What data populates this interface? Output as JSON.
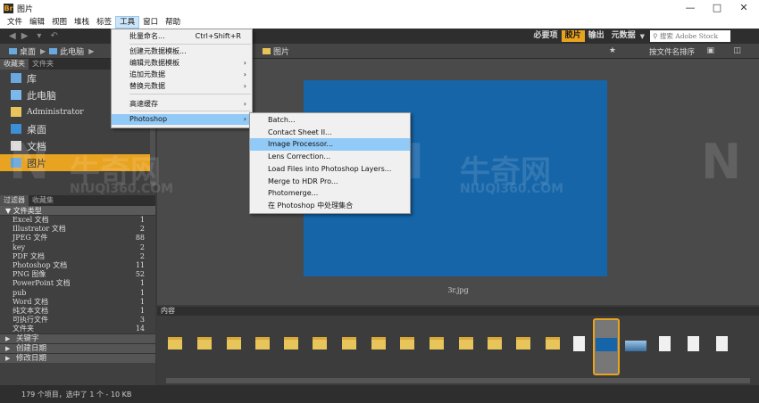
{
  "window": {
    "title": "图片"
  },
  "menubar": {
    "items": [
      "文件",
      "编辑",
      "视图",
      "堆栈",
      "标签",
      "工具",
      "窗口",
      "帮助"
    ],
    "active_index": 5
  },
  "toolbar": {
    "workspaces": [
      "必要项",
      "胶片",
      "输出",
      "元数据"
    ],
    "active_workspace": "胶片",
    "search_placeholder": "搜索 Adobe Stock"
  },
  "pathbar": {
    "crumbs": [
      "桌面",
      "此电脑",
      "图片"
    ],
    "sort_label": "按文件名排序"
  },
  "left_panel": {
    "tabs": [
      "收藏夹",
      "文件夹"
    ],
    "favorites": [
      {
        "label": "库",
        "icon": "library-icon"
      },
      {
        "label": "此电脑",
        "icon": "computer-icon"
      },
      {
        "label": "Administrator",
        "icon": "user-folder-icon"
      },
      {
        "label": "桌面",
        "icon": "desktop-icon"
      },
      {
        "label": "文档",
        "icon": "documents-icon"
      },
      {
        "label": "图片",
        "icon": "pictures-icon",
        "selected": true
      }
    ],
    "filter_tabs": [
      "过滤器",
      "收藏集"
    ],
    "filter_heading": "文件类型",
    "filter_rows": [
      {
        "label": "Excel 文档",
        "count": "1"
      },
      {
        "label": "Illustrator 文档",
        "count": "2"
      },
      {
        "label": "JPEG 文件",
        "count": "88"
      },
      {
        "label": "key",
        "count": "2"
      },
      {
        "label": "PDF 文档",
        "count": "2"
      },
      {
        "label": "Photoshop 文档",
        "count": "11"
      },
      {
        "label": "PNG 图像",
        "count": "52"
      },
      {
        "label": "PowerPoint 文档",
        "count": "1"
      },
      {
        "label": "pub",
        "count": "1"
      },
      {
        "label": "Word 文档",
        "count": "1"
      },
      {
        "label": "纯文本文档",
        "count": "1"
      },
      {
        "label": "可执行文件",
        "count": "3"
      },
      {
        "label": "文件夹",
        "count": "14"
      }
    ],
    "sub_sections": [
      "关键字",
      "创建日期",
      "修改日期"
    ]
  },
  "preview": {
    "filename": "3r.jpg",
    "image_color": "#1565a8"
  },
  "filmstrip": {
    "tab_label": "内容"
  },
  "status": {
    "text": "179 个项目，选中了 1 个 - 10 KB"
  },
  "tools_menu": {
    "items": [
      {
        "label": "批量命名...",
        "shortcut": "Ctrl+Shift+R",
        "submenu": false
      },
      {
        "label": "创建元数据模板...",
        "submenu": false
      },
      {
        "label": "编辑元数据模板",
        "submenu": true
      },
      {
        "label": "追加元数据",
        "submenu": true
      },
      {
        "label": "替换元数据",
        "submenu": true
      },
      {
        "label": "高速缓存",
        "submenu": true
      },
      {
        "label": "Photoshop",
        "submenu": true,
        "highlighted": true
      }
    ]
  },
  "photoshop_menu": {
    "items": [
      "Batch...",
      "Contact Sheet II...",
      "Image Processor...",
      "Lens Correction...",
      "Load Files into Photoshop Layers...",
      "Merge to HDR Pro...",
      "Photomerge...",
      "在 Photoshop 中处理集合"
    ],
    "highlighted_index": 2
  },
  "watermark": {
    "brand": "牛奇网",
    "url": "NIUQI360.COM"
  },
  "colors": {
    "accent": "#e8a320",
    "menu_highlight": "#91c9f7",
    "preview_blue": "#1565a8"
  }
}
